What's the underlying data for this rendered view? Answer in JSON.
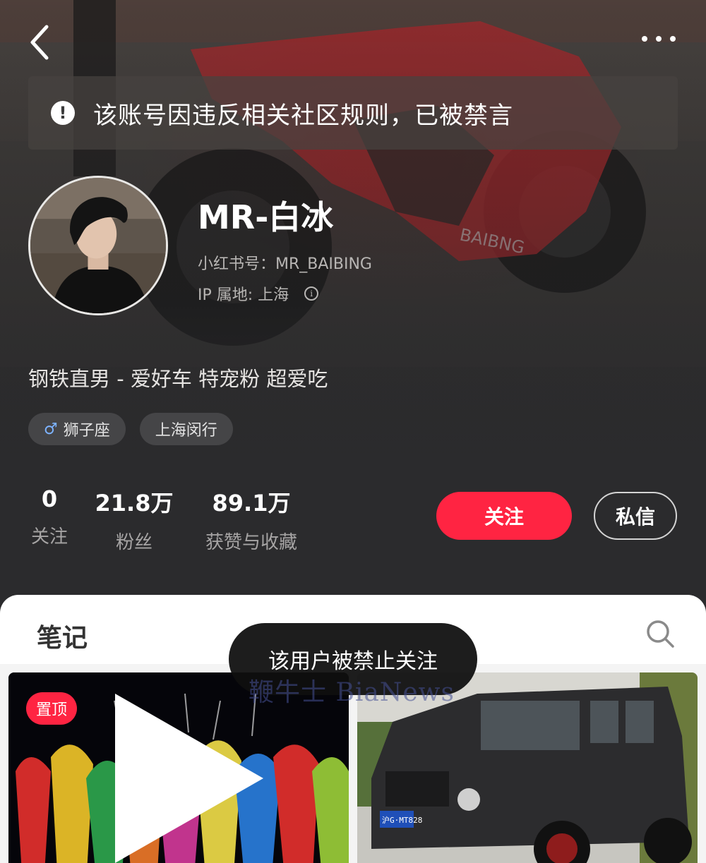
{
  "top_bar": {
    "back_icon": "chevron-left-icon",
    "more_icon": "more-dots-icon"
  },
  "ban_notice": {
    "icon": "exclamation-circle-icon",
    "text": "该账号因违反相关社区规则，已被禁言"
  },
  "profile": {
    "nickname": "MR-白冰",
    "red_id": "小红书号：MR_BAIBING",
    "ip_location": "IP 属地: 上海",
    "ip_info_icon": "ⓘ",
    "bio": "钢铁直男 - 爱好车 特宠粉 超爱吃",
    "tags": [
      {
        "icon": "♂",
        "label": "狮子座"
      },
      {
        "label": "上海闵行"
      }
    ]
  },
  "stats": [
    {
      "value": "0",
      "label": "关注"
    },
    {
      "value": "21.8万",
      "label": "粉丝"
    },
    {
      "value": "89.1万",
      "label": "获赞与收藏"
    }
  ],
  "actions": {
    "follow_label": "关注",
    "message_label": "私信"
  },
  "content": {
    "tab_label": "笔记",
    "search_icon": "search-icon",
    "cards": [
      {
        "badge": "置顶",
        "type": "video",
        "image": "fireworks-photo"
      },
      {
        "image": "black-suv-photo",
        "plate": "沪G·MT828"
      }
    ]
  },
  "toast": {
    "text": "该用户被禁止关注"
  },
  "watermark": {
    "text": "鞭牛士 BiaNews"
  },
  "colors": {
    "accent": "#ff2442",
    "header_bg": "#2b2b2d",
    "sheet_bg": "#ffffff"
  }
}
